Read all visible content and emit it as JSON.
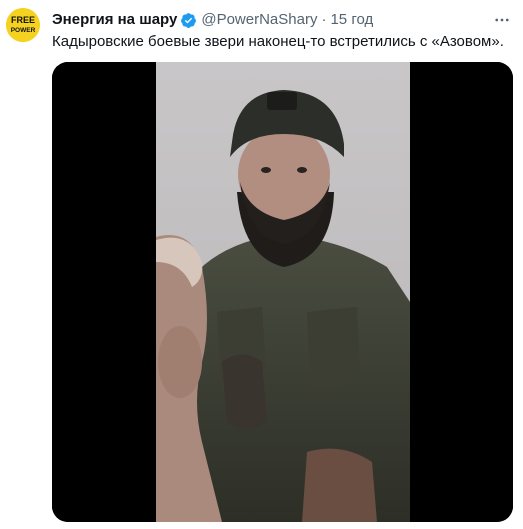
{
  "tweet": {
    "author": {
      "display_name": "Энергия на шару",
      "handle": "@PowerNaShary",
      "avatar_text_line1": "FREE",
      "avatar_text_line2": "POWER",
      "verified": true
    },
    "separator": "·",
    "time": "15 год",
    "text": "Кадыровские боевые звери наконец-то встретились с «Азовом».",
    "media": {
      "type": "video",
      "icon": "video-frame"
    },
    "menu_icon": "more-icon"
  },
  "colors": {
    "primary_text": "#0f1419",
    "secondary_text": "#536471",
    "verified_badge": "#1d9bf0",
    "avatar_bg": "#f4d21f",
    "media_bg": "#000000"
  }
}
